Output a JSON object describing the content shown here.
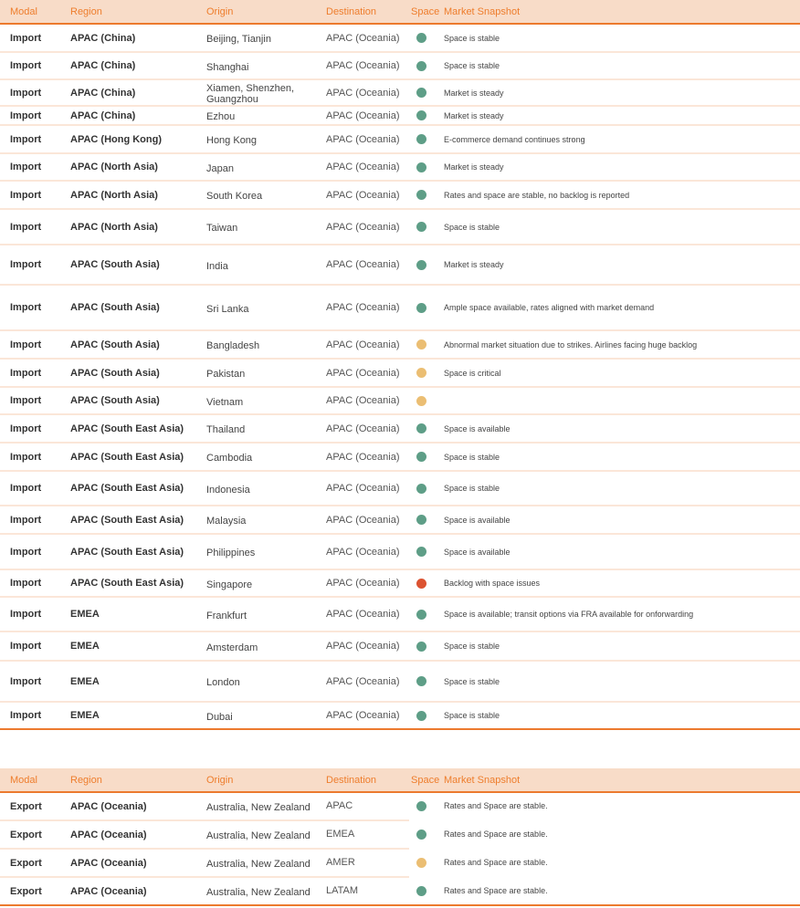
{
  "colors": {
    "header_bg": "#f8dcc8",
    "header_text": "#ee7d2c",
    "accent_line": "#ec7a2e",
    "row_divider": "#fbe6d8",
    "status_green": "#5e9e87",
    "status_amber": "#ebbe73",
    "status_red": "#dc5331"
  },
  "import_table": {
    "headers": {
      "modal": "Modal",
      "region": "Region",
      "origin": "Origin",
      "destination": "Destination",
      "space": "Space",
      "market_snapshot": "Market Snapshot"
    },
    "rows": [
      {
        "modal": "Import",
        "region": "APAC (China)",
        "origin": "Beijing, Tianjin",
        "destination": "APAC (Oceania)",
        "space": "green",
        "snapshot": "Space is stable"
      },
      {
        "modal": "Import",
        "region": "APAC (China)",
        "origin": "Shanghai",
        "destination": "APAC (Oceania)",
        "space": "green",
        "snapshot": "Space is stable"
      },
      {
        "modal": "Import",
        "region": "APAC (China)",
        "origin": "Xiamen, Shenzhen, Guangzhou",
        "destination": "APAC (Oceania)",
        "space": "green",
        "snapshot": "Market is steady"
      },
      {
        "modal": "Import",
        "region": "APAC (China)",
        "origin": "Ezhou",
        "destination": "APAC (Oceania)",
        "space": "green",
        "snapshot": "Market is steady"
      },
      {
        "modal": "Import",
        "region": "APAC (Hong Kong)",
        "origin": "Hong Kong",
        "destination": "APAC (Oceania)",
        "space": "green",
        "snapshot": "E-commerce demand continues strong"
      },
      {
        "modal": "Import",
        "region": "APAC (North Asia)",
        "origin": "Japan",
        "destination": "APAC (Oceania)",
        "space": "green",
        "snapshot": "Market is steady"
      },
      {
        "modal": "Import",
        "region": "APAC (North Asia)",
        "origin": "South Korea",
        "destination": "APAC (Oceania)",
        "space": "green",
        "snapshot": "Rates and space are stable, no backlog is reported"
      },
      {
        "modal": "Import",
        "region": "APAC (North Asia)",
        "origin": "Taiwan",
        "destination": "APAC (Oceania)",
        "space": "green",
        "snapshot": "Space is stable"
      },
      {
        "modal": "Import",
        "region": "APAC (South Asia)",
        "origin": "India",
        "destination": "APAC (Oceania)",
        "space": "green",
        "snapshot": "Market is steady"
      },
      {
        "modal": "Import",
        "region": "APAC (South Asia)",
        "origin": "Sri Lanka",
        "destination": "APAC (Oceania)",
        "space": "green",
        "snapshot": "Ample space available, rates aligned with market demand"
      },
      {
        "modal": "Import",
        "region": "APAC (South Asia)",
        "origin": "Bangladesh",
        "destination": "APAC (Oceania)",
        "space": "amber",
        "snapshot": "Abnormal market situation due to strikes. Airlines facing huge backlog"
      },
      {
        "modal": "Import",
        "region": "APAC (South Asia)",
        "origin": "Pakistan",
        "destination": "APAC (Oceania)",
        "space": "amber",
        "snapshot": "Space is critical"
      },
      {
        "modal": "Import",
        "region": "APAC (South Asia)",
        "origin": "Vietnam",
        "destination": "APAC (Oceania)",
        "space": "amber",
        "snapshot": ""
      },
      {
        "modal": "Import",
        "region": "APAC (South East Asia)",
        "origin": "Thailand",
        "destination": "APAC (Oceania)",
        "space": "green",
        "snapshot": "Space is available"
      },
      {
        "modal": "Import",
        "region": "APAC (South East Asia)",
        "origin": "Cambodia",
        "destination": "APAC (Oceania)",
        "space": "green",
        "snapshot": "Space is stable"
      },
      {
        "modal": "Import",
        "region": "APAC (South East Asia)",
        "origin": "Indonesia",
        "destination": "APAC (Oceania)",
        "space": "green",
        "snapshot": "Space is stable"
      },
      {
        "modal": "Import",
        "region": "APAC (South East Asia)",
        "origin": "Malaysia",
        "destination": "APAC (Oceania)",
        "space": "green",
        "snapshot": "Space is available"
      },
      {
        "modal": "Import",
        "region": "APAC (South East Asia)",
        "origin": "Philippines",
        "destination": "APAC (Oceania)",
        "space": "green",
        "snapshot": "Space is available"
      },
      {
        "modal": "Import",
        "region": "APAC (South East Asia)",
        "origin": "Singapore",
        "destination": "APAC (Oceania)",
        "space": "red",
        "snapshot": "Backlog with space issues"
      },
      {
        "modal": "Import",
        "region": "EMEA",
        "origin": "Frankfurt",
        "destination": "APAC (Oceania)",
        "space": "green",
        "snapshot": "Space is available; transit options via FRA available for onforwarding"
      },
      {
        "modal": "Import",
        "region": "EMEA",
        "origin": "Amsterdam",
        "destination": "APAC (Oceania)",
        "space": "green",
        "snapshot": "Space is stable"
      },
      {
        "modal": "Import",
        "region": "EMEA",
        "origin": "London",
        "destination": "APAC (Oceania)",
        "space": "green",
        "snapshot": "Space is stable"
      },
      {
        "modal": "Import",
        "region": "EMEA",
        "origin": "Dubai",
        "destination": "APAC (Oceania)",
        "space": "green",
        "snapshot": "Space is stable"
      }
    ]
  },
  "export_table": {
    "headers": {
      "modal": "Modal",
      "region": "Region",
      "origin": "Origin",
      "destination": "Destination",
      "space": "Space",
      "market_snapshot": "Market Snapshot"
    },
    "rows": [
      {
        "modal": "Export",
        "region": "APAC (Oceania)",
        "origin": "Australia, New Zealand",
        "destination": "APAC",
        "space": "green",
        "snapshot": "Rates and Space are stable."
      },
      {
        "modal": "Export",
        "region": "APAC (Oceania)",
        "origin": "Australia, New Zealand",
        "destination": "EMEA",
        "space": "green",
        "snapshot": "Rates and Space are stable."
      },
      {
        "modal": "Export",
        "region": "APAC (Oceania)",
        "origin": "Australia, New Zealand",
        "destination": "AMER",
        "space": "amber",
        "snapshot": "Rates and Space are stable."
      },
      {
        "modal": "Export",
        "region": "APAC (Oceania)",
        "origin": "Australia, New Zealand",
        "destination": "LATAM",
        "space": "green",
        "snapshot": "Rates and Space are stable."
      }
    ]
  }
}
